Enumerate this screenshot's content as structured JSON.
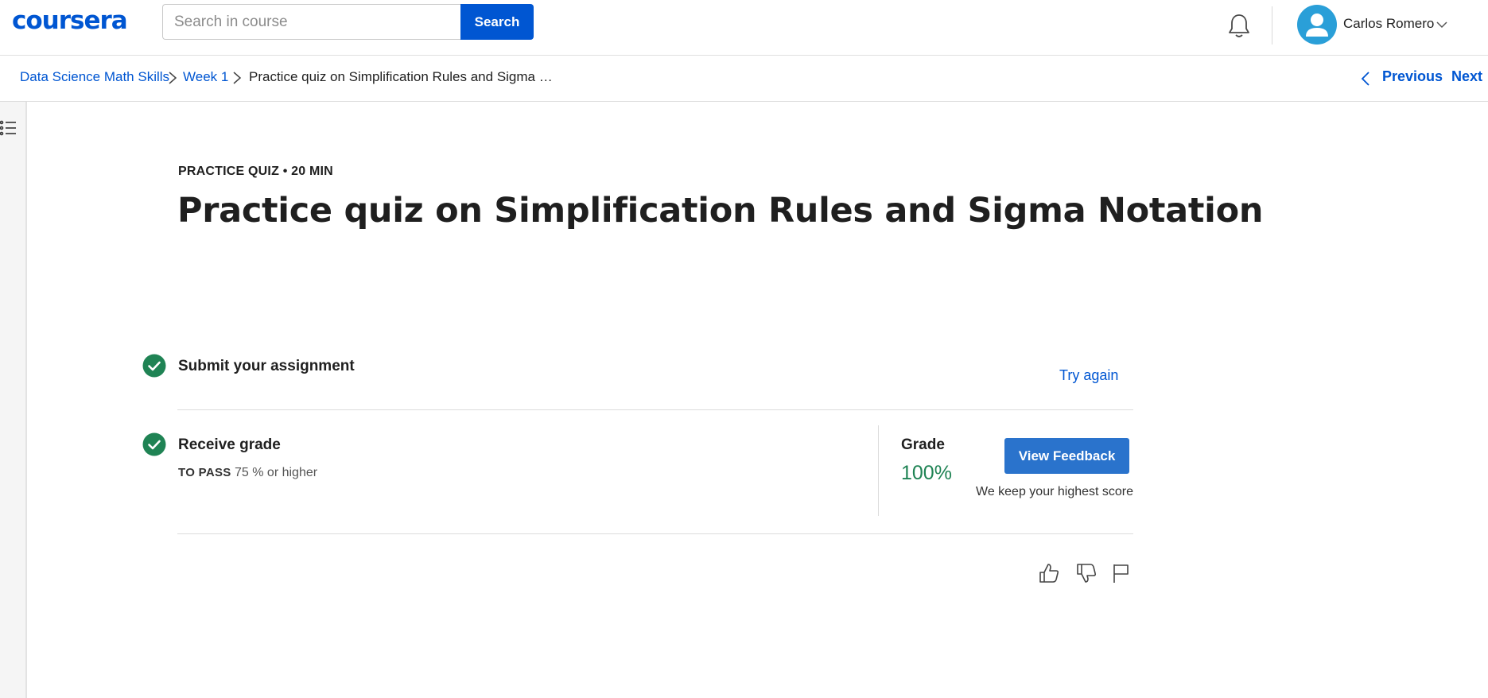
{
  "header": {
    "logo": "coursera",
    "search": {
      "placeholder": "Search in course",
      "value": "",
      "button_label": "Search"
    },
    "user": {
      "name": "Carlos Romero"
    }
  },
  "breadcrumb": {
    "items": [
      "Data Science Math Skills",
      "Week 1",
      "Practice quiz on Simplification Rules and Sigma …"
    ],
    "previous_label": "Previous",
    "next_label": "Next"
  },
  "quiz": {
    "eyebrow": "PRACTICE QUIZ • 20 MIN",
    "title": "Practice quiz on Simplification Rules and Sigma Notation"
  },
  "steps": {
    "submit": {
      "title": "Submit your assignment",
      "action_label": "Try again"
    },
    "grade": {
      "title": "Receive grade",
      "pass_label": "TO PASS",
      "pass_value": "75 % or higher",
      "grade_label": "Grade",
      "grade_value": "100%",
      "feedback_button": "View Feedback",
      "note": "We keep your highest score"
    }
  },
  "colors": {
    "brand": "#0056d2",
    "success": "#1f8354",
    "check": "#1f8354",
    "button": "#2a73cc"
  },
  "icons": [
    "bell-icon",
    "user-avatar-icon",
    "chevron-down-icon",
    "chevron-right-icon",
    "chevron-left-icon",
    "outline-list-icon",
    "check-circle-icon",
    "thumbs-up-icon",
    "thumbs-down-icon",
    "flag-icon"
  ]
}
